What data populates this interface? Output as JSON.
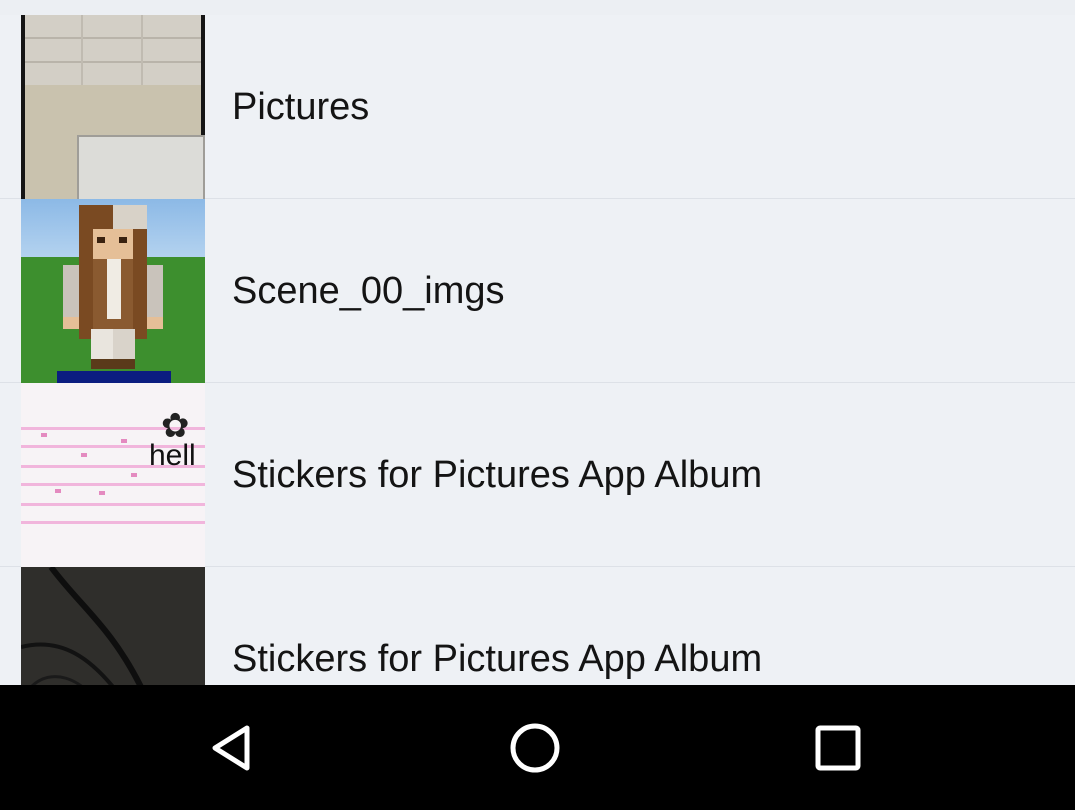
{
  "albums": [
    {
      "name": "Pictures",
      "thumb_icon": "office-photo-thumbnail"
    },
    {
      "name": "Scene_00_imgs",
      "thumb_icon": "minecraft-character-thumbnail"
    },
    {
      "name": "Stickers for Pictures App Album",
      "thumb_icon": "stickers-thumbnail"
    },
    {
      "name": "Stickers for Pictures App Album",
      "thumb_icon": "dark-cable-photo-thumbnail"
    }
  ],
  "navbar": {
    "back_icon": "back-triangle-icon",
    "home_icon": "home-circle-icon",
    "recents_icon": "recents-square-icon"
  },
  "colors": {
    "list_background": "#eef1f5",
    "divider": "#dde1e7",
    "label_text": "#141414",
    "navbar_background": "#000000",
    "navbar_icon": "#ffffff"
  }
}
